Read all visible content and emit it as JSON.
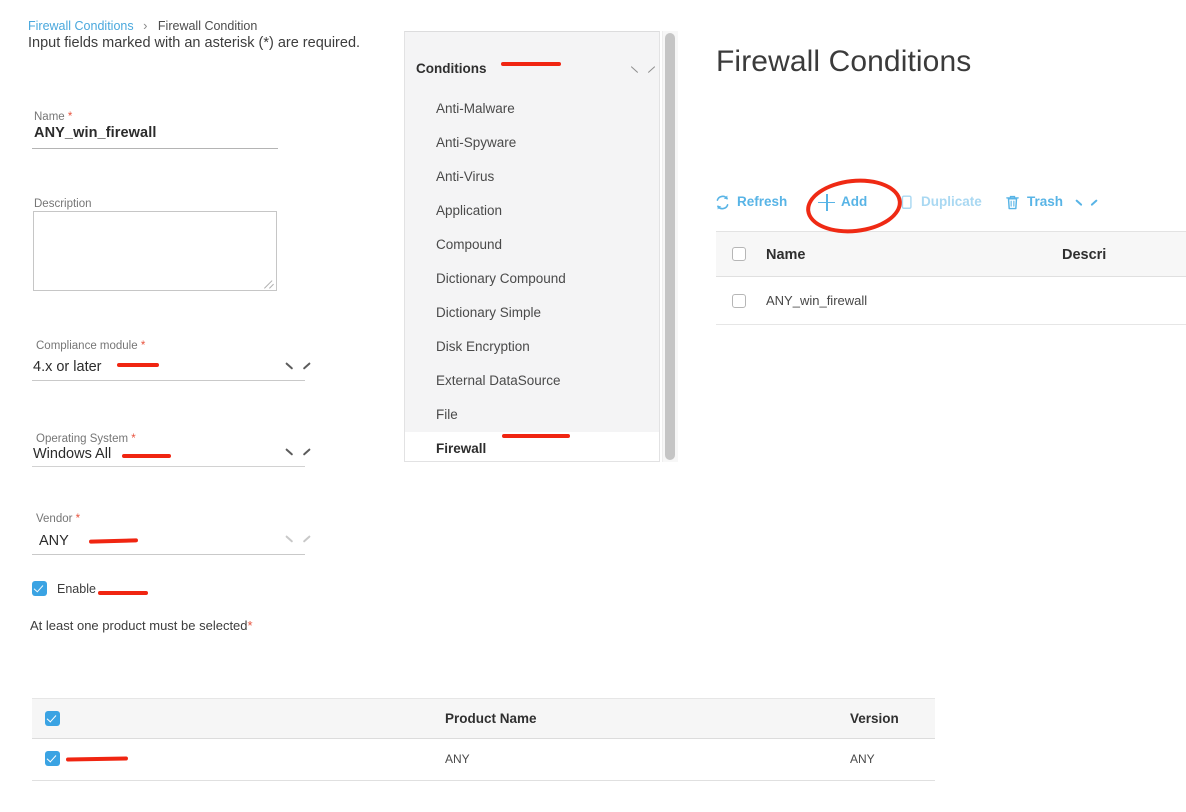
{
  "breadcrumb": {
    "parent": "Firewall Conditions",
    "separator": "›",
    "current": "Firewall Condition"
  },
  "notice": "Input fields marked with an asterisk (*) are required.",
  "form": {
    "name": {
      "label": "Name",
      "required": "*",
      "value": "ANY_win_firewall"
    },
    "description": {
      "label": "Description",
      "value": "",
      "placeholder": ""
    },
    "compliance_module": {
      "label": "Compliance module",
      "required": "*",
      "value": "4.x or later"
    },
    "operating_system": {
      "label": "Operating System",
      "required": "*",
      "value": "Windows All"
    },
    "vendor": {
      "label": "Vendor",
      "required": "*",
      "value": "ANY"
    },
    "enable": {
      "label": "Enable",
      "checked": true
    },
    "product_note": "At least one product must be selected",
    "product_note_star": "*"
  },
  "conditions_panel": {
    "title": "Conditions",
    "chevron_icon": "chevron-down-icon",
    "items": [
      {
        "label": "Anti-Malware",
        "selected": false
      },
      {
        "label": "Anti-Spyware",
        "selected": false
      },
      {
        "label": "Anti-Virus",
        "selected": false
      },
      {
        "label": "Application",
        "selected": false
      },
      {
        "label": "Compound",
        "selected": false
      },
      {
        "label": "Dictionary Compound",
        "selected": false
      },
      {
        "label": "Dictionary Simple",
        "selected": false
      },
      {
        "label": "Disk Encryption",
        "selected": false
      },
      {
        "label": "External DataSource",
        "selected": false
      },
      {
        "label": "File",
        "selected": false
      },
      {
        "label": "Firewall",
        "selected": true
      }
    ]
  },
  "right_panel": {
    "title": "Firewall Conditions",
    "toolbar": {
      "refresh": {
        "label": "Refresh",
        "icon": "refresh-icon",
        "disabled": false
      },
      "add": {
        "label": "Add",
        "icon": "plus-icon",
        "disabled": false
      },
      "duplicate": {
        "label": "Duplicate",
        "icon": "duplicate-icon",
        "disabled": true
      },
      "trash": {
        "label": "Trash",
        "icon": "trash-icon",
        "chevron": "chevron-down-icon",
        "disabled": false
      }
    },
    "table": {
      "columns": [
        "Name",
        "Descri"
      ],
      "rows": [
        {
          "checked": false,
          "name": "ANY_win_firewall"
        }
      ]
    }
  },
  "products_table": {
    "columns": [
      "Product Name",
      "Version"
    ],
    "header_checked": true,
    "rows": [
      {
        "checked": true,
        "product_name": "ANY",
        "version": "ANY"
      }
    ]
  },
  "annotations": {
    "color": "#f02511",
    "marks": [
      "compliance-module-underline",
      "operating-system-underline",
      "vendor-underline",
      "enable-underline",
      "conditions-underline",
      "firewall-underline",
      "product-row-underline",
      "add-button-ellipse"
    ]
  }
}
